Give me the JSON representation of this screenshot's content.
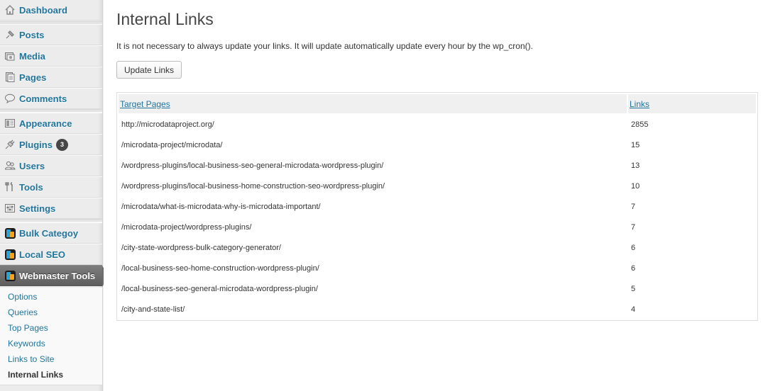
{
  "sidebar": {
    "items": [
      {
        "label": "Dashboard",
        "icon": "dashboard-icon"
      },
      {
        "label": "Posts",
        "icon": "pin-icon"
      },
      {
        "label": "Media",
        "icon": "media-icon"
      },
      {
        "label": "Pages",
        "icon": "pages-icon"
      },
      {
        "label": "Comments",
        "icon": "comment-icon"
      },
      {
        "label": "Appearance",
        "icon": "appearance-icon"
      },
      {
        "label": "Plugins",
        "icon": "plug-icon",
        "badge": "3"
      },
      {
        "label": "Users",
        "icon": "users-icon"
      },
      {
        "label": "Tools",
        "icon": "tools-icon"
      },
      {
        "label": "Settings",
        "icon": "settings-icon"
      },
      {
        "label": "Bulk Categoy",
        "icon": "plugin-logo-icon"
      },
      {
        "label": "Local SEO",
        "icon": "plugin-logo-icon"
      },
      {
        "label": "Webmaster Tools",
        "icon": "plugin-logo-icon",
        "current": true
      }
    ],
    "submenu": [
      {
        "label": "Options"
      },
      {
        "label": "Queries"
      },
      {
        "label": "Top Pages"
      },
      {
        "label": "Keywords"
      },
      {
        "label": "Links to Site"
      },
      {
        "label": "Internal Links",
        "active": true
      }
    ]
  },
  "main": {
    "title": "Internal Links",
    "description": "It is not necessary to always update your links. It will update automatically update every hour by the wp_cron().",
    "update_button": "Update Links",
    "table": {
      "headers": [
        "Target Pages",
        "Links"
      ],
      "rows": [
        [
          "http://microdataproject.org/",
          "2855"
        ],
        [
          "/microdata-project/microdata/",
          "15"
        ],
        [
          "/wordpress-plugins/local-business-seo-general-microdata-wordpress-plugin/",
          "13"
        ],
        [
          "/wordpress-plugins/local-business-home-construction-seo-wordpress-plugin/",
          "10"
        ],
        [
          "/microdata/what-is-microdata-why-is-microdata-important/",
          "7"
        ],
        [
          "/microdata-project/wordpress-plugins/",
          "7"
        ],
        [
          "/city-state-wordpress-bulk-category-generator/",
          "6"
        ],
        [
          "/local-business-seo-home-construction-wordpress-plugin/",
          "6"
        ],
        [
          "/local-business-seo-general-microdata-wordpress-plugin/",
          "5"
        ],
        [
          "/city-and-state-list/",
          "4"
        ]
      ]
    }
  },
  "colors": {
    "link": "#21759b",
    "sidebar_bg": "#ececec",
    "current_menu_bg": "#6d6d6d",
    "badge_bg": "#464646"
  }
}
